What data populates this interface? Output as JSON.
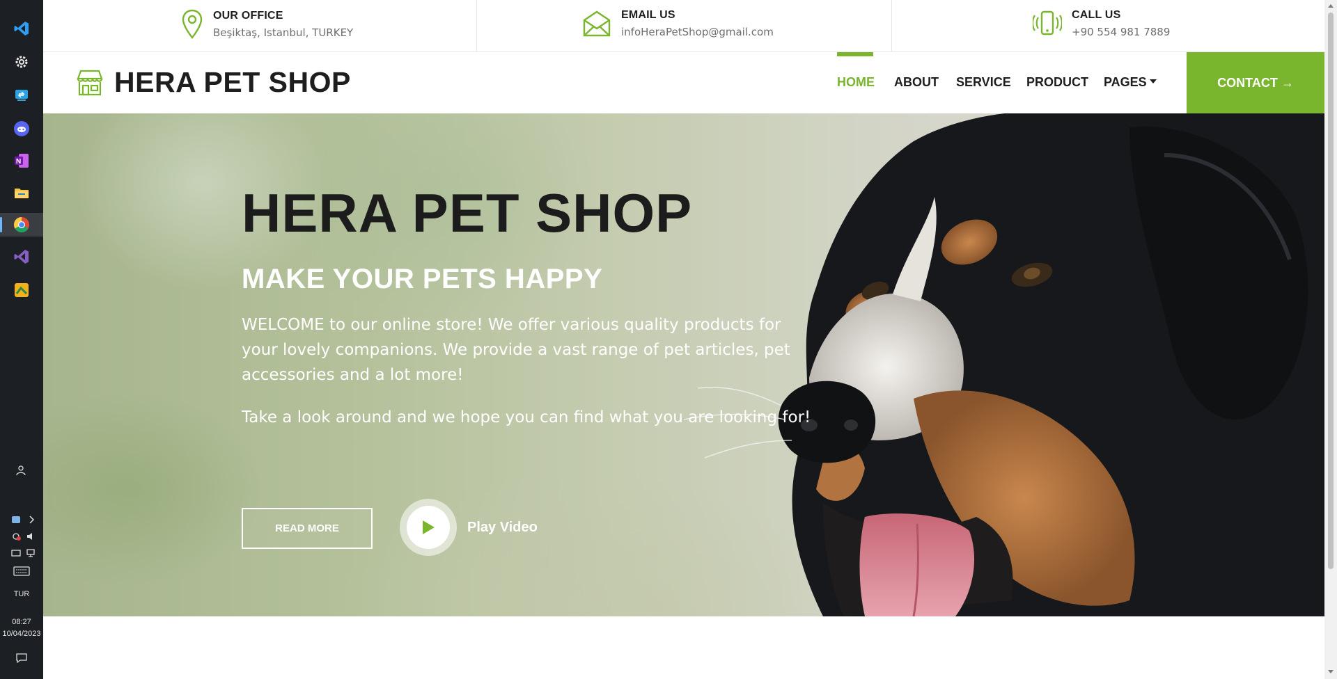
{
  "taskbar": {
    "apps": [
      {
        "name": "vscode-icon",
        "color": "#2f9ef4"
      },
      {
        "name": "settings-icon",
        "color": "#e8e8e8"
      },
      {
        "name": "remote-desktop-icon",
        "color": "#2aa3e0"
      },
      {
        "name": "discord-icon",
        "color": "#5865f2"
      },
      {
        "name": "onenote-icon",
        "color": "#7719aa"
      },
      {
        "name": "file-explorer-icon",
        "color": "#f6c343"
      },
      {
        "name": "chrome-icon",
        "color": "#dd4b39"
      },
      {
        "name": "visual-studio-icon",
        "color": "#865fc5"
      },
      {
        "name": "app-icon",
        "color": "#f2b21b"
      }
    ],
    "language": "TUR",
    "time": "08:27",
    "date": "10/04/2023"
  },
  "infobar": {
    "office": {
      "title": "OUR OFFICE",
      "value": "Beşiktaş, Istanbul, TURKEY"
    },
    "email": {
      "title": "EMAIL US",
      "value": "infoHeraPetShop@gmail.com"
    },
    "call": {
      "title": "CALL US",
      "value": "+90 554 981 7889"
    }
  },
  "nav": {
    "logo": "HERA PET SHOP",
    "items": [
      {
        "label": "HOME",
        "active": true
      },
      {
        "label": "ABOUT"
      },
      {
        "label": "SERVICE"
      },
      {
        "label": "PRODUCT"
      },
      {
        "label": "PAGES"
      }
    ],
    "contact": "CONTACT →"
  },
  "hero": {
    "title": "HERA PET SHOP",
    "subtitle": "MAKE YOUR PETS HAPPY",
    "paragraph1": "WELCOME to our online store! We offer various quality products for your lovely companions. We provide a vast range of pet articles, pet accessories and a lot more!",
    "paragraph2": "Take a look around and we hope you can find what you are looking for!",
    "read_more": "READ MORE",
    "play_video": "Play Video"
  },
  "colors": {
    "accent": "#7ab52e",
    "text_dark": "#1e1e1e"
  }
}
